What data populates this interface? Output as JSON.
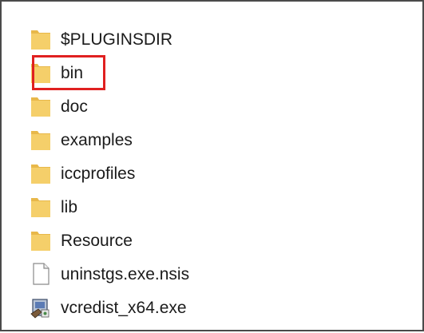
{
  "explorer": {
    "items": [
      {
        "name": "$PLUGINSDIR",
        "type": "folder",
        "icon": "folder-icon"
      },
      {
        "name": "bin",
        "type": "folder",
        "icon": "folder-icon",
        "highlighted": true
      },
      {
        "name": "doc",
        "type": "folder",
        "icon": "folder-icon"
      },
      {
        "name": "examples",
        "type": "folder",
        "icon": "folder-icon"
      },
      {
        "name": "iccprofiles",
        "type": "folder",
        "icon": "folder-icon"
      },
      {
        "name": "lib",
        "type": "folder",
        "icon": "folder-icon"
      },
      {
        "name": "Resource",
        "type": "folder",
        "icon": "folder-icon"
      },
      {
        "name": "uninstgs.exe.nsis",
        "type": "file",
        "icon": "file-icon"
      },
      {
        "name": "vcredist_x64.exe",
        "type": "installer",
        "icon": "installer-icon"
      }
    ]
  },
  "colors": {
    "folder": "#f5cf6a",
    "folder_shade": "#e8b84a",
    "highlight": "#e02020",
    "border": "#4a4a4a"
  }
}
